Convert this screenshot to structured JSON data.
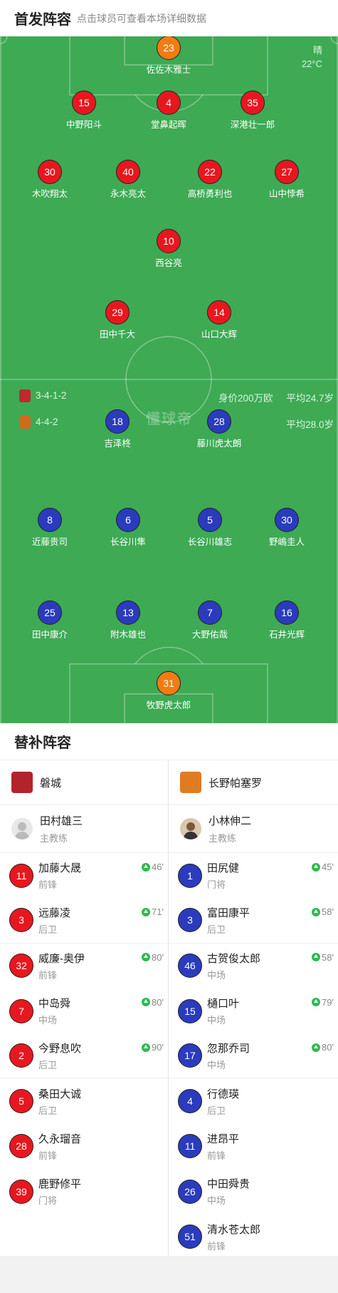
{
  "header": {
    "title": "首发阵容",
    "subtitle": "点击球员可查看本场详细数据"
  },
  "weather": {
    "condition": "晴",
    "temp": "22°C"
  },
  "watermark": "懂球帝",
  "home_team": {
    "formation": "3-4-1-2",
    "value": "身价200万欧",
    "avg_age": "平均24.7岁",
    "color": "#e8171f"
  },
  "away_team": {
    "formation": "4-4-2",
    "avg_age": "平均28.0岁",
    "color": "#2a3bbd"
  },
  "home_players": [
    {
      "number": "23",
      "name": "佐佐木雅士",
      "kit": "orange"
    },
    {
      "number": "15",
      "name": "中野阳斗",
      "kit": "red"
    },
    {
      "number": "4",
      "name": "堂鼻起晖",
      "kit": "red"
    },
    {
      "number": "35",
      "name": "深港壮一郎",
      "kit": "red"
    },
    {
      "number": "30",
      "name": "木吹翔太",
      "kit": "red",
      "sub_off": "80'",
      "goal": true
    },
    {
      "number": "40",
      "name": "永木亮太",
      "kit": "red",
      "sub_off": "71'"
    },
    {
      "number": "22",
      "name": "高桥勇利也",
      "kit": "red"
    },
    {
      "number": "27",
      "name": "山中悖希",
      "kit": "red",
      "sub_off": "90'",
      "goal": true
    },
    {
      "number": "10",
      "name": "西谷亮",
      "kit": "red"
    },
    {
      "number": "29",
      "name": "田中千大",
      "kit": "red",
      "sub_off": "46'"
    },
    {
      "number": "14",
      "name": "山口大辉",
      "kit": "red",
      "sub_off": "80'"
    }
  ],
  "away_players": [
    {
      "number": "18",
      "name": "吉泽柊",
      "kit": "blue",
      "card": "yellow"
    },
    {
      "number": "28",
      "name": "藤川虎太朗",
      "kit": "blue"
    },
    {
      "number": "8",
      "name": "近藤贵司",
      "kit": "blue",
      "sub_off": "79'"
    },
    {
      "number": "6",
      "name": "长谷川隼",
      "kit": "blue"
    },
    {
      "number": "5",
      "name": "长谷川雄志",
      "kit": "blue",
      "sub_off": "58'"
    },
    {
      "number": "30",
      "name": "野嶋圭人",
      "kit": "blue",
      "sub_off": "45'"
    },
    {
      "number": "25",
      "name": "田中康介",
      "kit": "blue"
    },
    {
      "number": "13",
      "name": "附木雄也",
      "kit": "blue"
    },
    {
      "number": "7",
      "name": "大野佑哉",
      "kit": "blue",
      "sub_off": "80'"
    },
    {
      "number": "16",
      "name": "石井光辉",
      "kit": "blue",
      "sub_off": "58'"
    },
    {
      "number": "31",
      "name": "牧野虎太郎",
      "kit": "orange",
      "card": "red"
    }
  ],
  "subs_section": {
    "title": "替补阵容"
  },
  "home_bench": {
    "team": "磐城",
    "coach": {
      "name": "田村雄三",
      "role": "主教练"
    },
    "players": [
      {
        "number": "11",
        "name": "加藤大晟",
        "pos": "前锋",
        "in": "46'"
      },
      {
        "number": "3",
        "name": "远藤凌",
        "pos": "后卫",
        "in": "71'"
      },
      {
        "number": "32",
        "name": "威廉-奥伊",
        "pos": "前锋",
        "in": "80'"
      },
      {
        "number": "7",
        "name": "中岛舜",
        "pos": "中场",
        "in": "80'"
      },
      {
        "number": "2",
        "name": "今野息吹",
        "pos": "后卫",
        "in": "90'"
      },
      {
        "number": "5",
        "name": "桑田大诚",
        "pos": "后卫"
      },
      {
        "number": "28",
        "name": "久永瑠音",
        "pos": "前锋"
      },
      {
        "number": "39",
        "name": "鹿野修平",
        "pos": "门将"
      }
    ]
  },
  "away_bench": {
    "team": "长野帕塞罗",
    "coach": {
      "name": "小林伸二",
      "role": "主教练"
    },
    "players": [
      {
        "number": "1",
        "name": "田尻健",
        "pos": "门将",
        "in": "45'"
      },
      {
        "number": "3",
        "name": "富田康平",
        "pos": "后卫",
        "in": "58'"
      },
      {
        "number": "46",
        "name": "古贺俊太郎",
        "pos": "中场",
        "in": "58'"
      },
      {
        "number": "15",
        "name": "樋口叶",
        "pos": "中场",
        "in": "79'"
      },
      {
        "number": "17",
        "name": "忽那乔司",
        "pos": "中场",
        "in": "80'"
      },
      {
        "number": "4",
        "name": "行德瑛",
        "pos": "后卫"
      },
      {
        "number": "11",
        "name": "进昂平",
        "pos": "前锋"
      },
      {
        "number": "26",
        "name": "中田舜贵",
        "pos": "中场"
      },
      {
        "number": "51",
        "name": "清水苍太郎",
        "pos": "前锋"
      }
    ]
  }
}
